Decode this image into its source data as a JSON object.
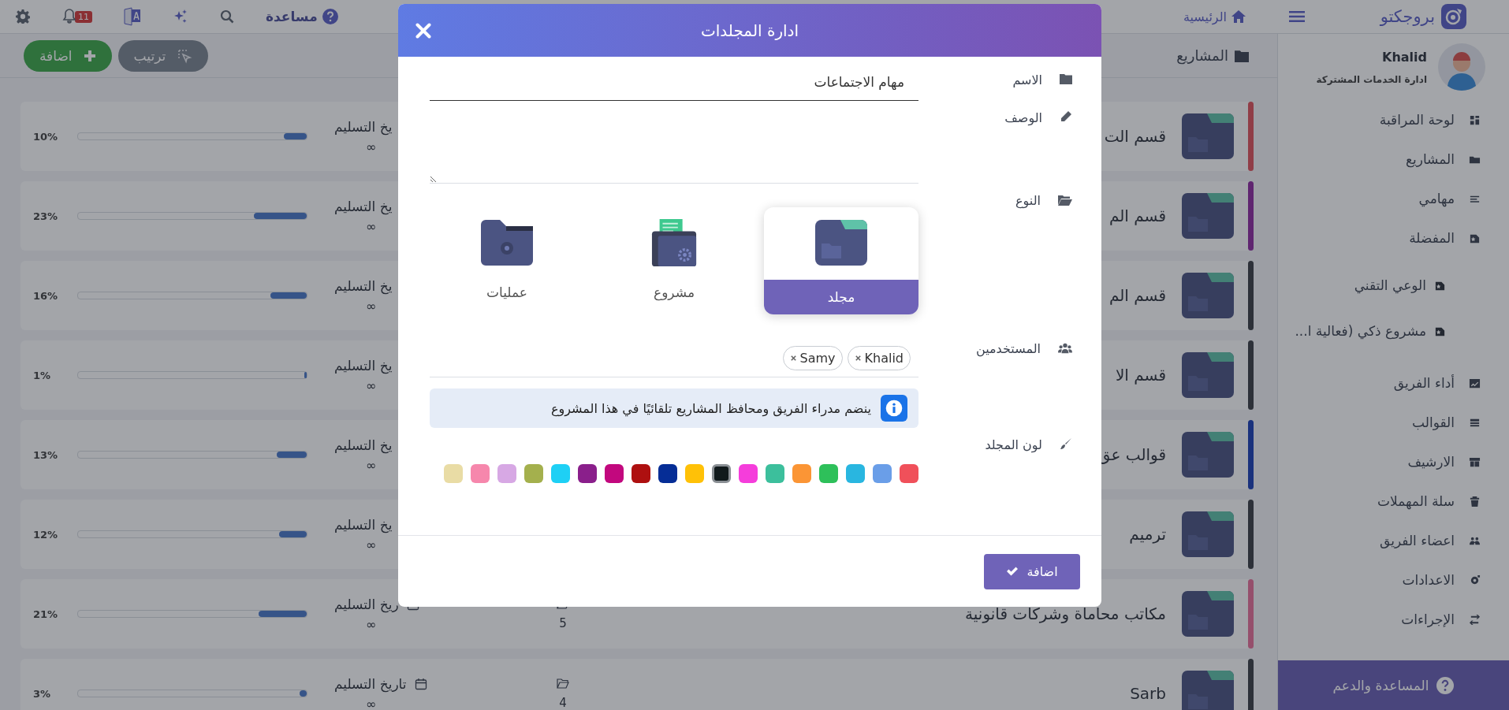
{
  "topbar": {
    "brand": "بروجكتو",
    "home": "الرئيسية",
    "help": "مساعدة",
    "notification_count": "11"
  },
  "user": {
    "name": "Khalid",
    "department": "ادارة الخدمات المشتركة"
  },
  "sidebar": {
    "items": [
      {
        "label": "لوحة المراقبة"
      },
      {
        "label": "المشاريع"
      },
      {
        "label": "مهامي"
      },
      {
        "label": "المفضلة",
        "children": [
          {
            "label": "الوعي التقني"
          },
          {
            "label": "مشروع ذكي (فعالية ا..."
          }
        ]
      },
      {
        "label": "أداء الفريق"
      },
      {
        "label": "القوالب"
      },
      {
        "label": "الارشيف"
      },
      {
        "label": "سلة المهملات"
      },
      {
        "label": "اعضاء الفريق"
      },
      {
        "label": "الاعدادات"
      },
      {
        "label": "الإجراءات"
      }
    ],
    "support": "المساعدة والدعم"
  },
  "header": {
    "title": "المشاريع",
    "sort_button": "ترتيب",
    "add_button": "اضافة"
  },
  "projects": [
    {
      "title": "قسم الت",
      "color": "#903d47",
      "date_label": "يخ التسليم",
      "date_value": "∞",
      "progress": "10%",
      "level": 0.1
    },
    {
      "title": "قسم الم",
      "color": "#5f2570",
      "date_label": "يخ التسليم",
      "date_value": "∞",
      "progress": "23%",
      "level": 0.23
    },
    {
      "title": "قسم الم",
      "color": "#2d3139",
      "date_label": "يخ التسليم",
      "date_value": "∞",
      "progress": "16%",
      "level": 0.16
    },
    {
      "title": "قسم الا",
      "color": "#2d3139",
      "date_label": "يخ التسليم",
      "date_value": "∞",
      "progress": "1%",
      "level": 0.01
    },
    {
      "title": "قوالب عق",
      "color": "#1a327d",
      "date_label": "يخ التسليم",
      "date_value": "∞",
      "progress": "13%",
      "level": 0.13
    },
    {
      "title": "ترميم",
      "color": "#2d3139",
      "date_label": "يخ التسليم",
      "date_value": "∞",
      "progress": "12%",
      "level": 0.12
    },
    {
      "title": "مكاتب محاماة وشركات قانونية",
      "color": "#954f6c",
      "date_label": "ريخ التسليم",
      "date_value": "∞",
      "count": "5",
      "progress": "21%",
      "level": 0.21
    },
    {
      "title": "Sarb",
      "color": "#2d3139",
      "date_label": "تاريخ التسليم",
      "date_value": "∞",
      "count": "4",
      "progress": "3%",
      "level": 0.03
    }
  ],
  "modal": {
    "title": "ادارة المجلدات",
    "name": {
      "label": "الاسم",
      "value": "مهام الاجتماعات"
    },
    "description": {
      "label": "الوصف"
    },
    "type": {
      "label": "النوع",
      "options": [
        {
          "label": "مجلد",
          "selected": true
        },
        {
          "label": "مشروع",
          "selected": false
        },
        {
          "label": "عمليات",
          "selected": false
        }
      ]
    },
    "users": {
      "label": "المستخدمين",
      "tags": [
        "Khalid",
        "Samy"
      ]
    },
    "note": "ينضم مدراء الفريق ومحافظ المشاريع تلقائيًا في هذا المشروع",
    "color": {
      "label": "لون المجلد",
      "swatches": [
        {
          "color": "#f0505a",
          "selected": false
        },
        {
          "color": "#6a9ee8",
          "selected": false
        },
        {
          "color": "#29b6e0",
          "selected": false
        },
        {
          "color": "#2ec05a",
          "selected": false
        },
        {
          "color": "#fb9535",
          "selected": false
        },
        {
          "color": "#3cbf9c",
          "selected": false
        },
        {
          "color": "#f53ddb",
          "selected": false
        },
        {
          "color": "#111a1c",
          "selected": true
        },
        {
          "color": "#ffc107",
          "selected": false
        },
        {
          "color": "#052d96",
          "selected": false
        },
        {
          "color": "#ae1010",
          "selected": false
        },
        {
          "color": "#c2087e",
          "selected": false
        },
        {
          "color": "#8a1f8b",
          "selected": false
        },
        {
          "color": "#1ed0f5",
          "selected": false
        },
        {
          "color": "#a4b04d",
          "selected": false
        },
        {
          "color": "#d7a8e4",
          "selected": false
        },
        {
          "color": "#f687ac",
          "selected": false
        },
        {
          "color": "#e9dca5",
          "selected": false
        }
      ]
    },
    "submit": "اضافة"
  }
}
